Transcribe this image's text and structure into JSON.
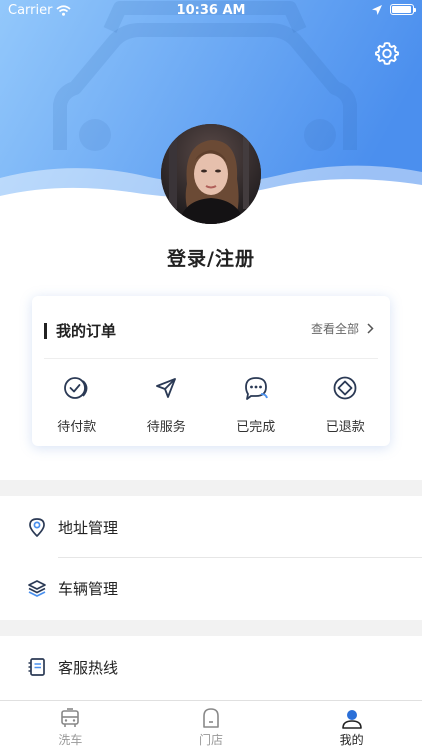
{
  "status_bar": {
    "carrier": "Carrier",
    "time": "10:36 AM"
  },
  "header": {
    "gradient_start": "#8ec5fb",
    "gradient_end": "#4a90ee",
    "settings_icon": "gear-icon"
  },
  "profile": {
    "login_label": "登录/注册"
  },
  "orders": {
    "title": "我的订单",
    "view_all": "查看全部",
    "items": [
      {
        "label": "待付款",
        "icon": "check-coins-icon"
      },
      {
        "label": "待服务",
        "icon": "paper-plane-icon"
      },
      {
        "label": "已完成",
        "icon": "chat-bubble-icon"
      },
      {
        "label": "已退款",
        "icon": "refund-diamond-icon"
      }
    ]
  },
  "menu": [
    {
      "label": "地址管理",
      "icon": "location-pin-icon"
    },
    {
      "label": "车辆管理",
      "icon": "layers-icon"
    },
    {
      "label": "客服热线",
      "icon": "document-icon"
    }
  ],
  "tabs": [
    {
      "label": "洗车",
      "icon": "car-wash-icon",
      "active": false
    },
    {
      "label": "门店",
      "icon": "store-icon",
      "active": false
    },
    {
      "label": "我的",
      "icon": "user-icon",
      "active": true
    }
  ],
  "colors": {
    "active_tab": "#2a6fd8",
    "inactive_tab": "#999999"
  }
}
